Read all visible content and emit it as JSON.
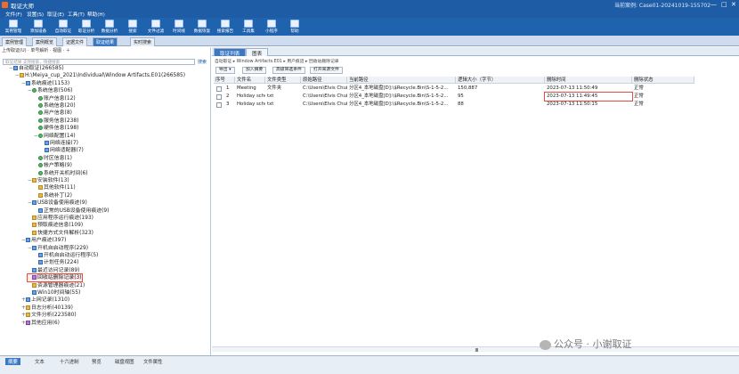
{
  "window": {
    "title": "取证大师",
    "case": "当前案例: Case01-20241019-155702",
    "controls": [
      "—",
      "□",
      "✕"
    ]
  },
  "menu": [
    "文件(F)",
    "设置(S)",
    "取证(E)",
    "工具(T)",
    "帮助(H)"
  ],
  "toolbar": [
    "案例管理",
    "添加设备",
    "自动取证",
    "取证分析",
    "数据分析",
    "搜索",
    "文件过滤",
    "时间线",
    "数据恢复",
    "搜索报告",
    "工具集",
    "小程序",
    "帮助"
  ],
  "tabs": [
    "案例管理",
    "案例概览",
    "证据文件",
    "取证结果",
    "实时搜索"
  ],
  "left": {
    "header": "上传取证(U)  ·  单号解析  ·  视图  ·  ＋",
    "search_placeholder": "取证结果  支持搜索，快捷搜索",
    "search_button": "搜索",
    "tree": [
      {
        "label": "自动取证(266585)",
        "depth": 0,
        "exp": "−",
        "icon": "b"
      },
      {
        "label": "H:\\Meiya_cup_2021\\Individual\\Window Artifacts.E01(266585)",
        "depth": 1,
        "exp": "−",
        "icon": "y"
      },
      {
        "label": "系统痕迹(1153)",
        "depth": 2,
        "exp": "−",
        "icon": "b"
      },
      {
        "label": "系统信息(506)",
        "depth": 3,
        "exp": "−",
        "icon": "g"
      },
      {
        "label": "账户信息(12)",
        "depth": 4,
        "exp": "",
        "icon": "g"
      },
      {
        "label": "系统信息(20)",
        "depth": 4,
        "exp": "",
        "icon": "g"
      },
      {
        "label": "用户信息(8)",
        "depth": 4,
        "exp": "",
        "icon": "g"
      },
      {
        "label": "服务信息(238)",
        "depth": 4,
        "exp": "",
        "icon": "g"
      },
      {
        "label": "硬件信息(198)",
        "depth": 4,
        "exp": "",
        "icon": "g"
      },
      {
        "label": "网络配置(14)",
        "depth": 4,
        "exp": "−",
        "icon": "g"
      },
      {
        "label": "网络连接(7)",
        "depth": 5,
        "exp": "",
        "icon": "b"
      },
      {
        "label": "网络适配器(7)",
        "depth": 5,
        "exp": "",
        "icon": "b"
      },
      {
        "label": "时区信息(1)",
        "depth": 4,
        "exp": "",
        "icon": "g"
      },
      {
        "label": "帐户策略(9)",
        "depth": 4,
        "exp": "",
        "icon": "g"
      },
      {
        "label": "系统开关机时间(6)",
        "depth": 4,
        "exp": "",
        "icon": "g"
      },
      {
        "label": "安装软件(13)",
        "depth": 3,
        "exp": "−",
        "icon": "y"
      },
      {
        "label": "其他软件(11)",
        "depth": 4,
        "exp": "",
        "icon": "y"
      },
      {
        "label": "系统补丁(2)",
        "depth": 4,
        "exp": "",
        "icon": "y"
      },
      {
        "label": "USB设备使用痕迹(9)",
        "depth": 3,
        "exp": "−",
        "icon": "b"
      },
      {
        "label": "正常的USB设备使用痕迹(9)",
        "depth": 4,
        "exp": "",
        "icon": "b"
      },
      {
        "label": "应用程序运行痕迹(193)",
        "depth": 3,
        "exp": "",
        "icon": "y"
      },
      {
        "label": "预取痕迹信息(109)",
        "depth": 3,
        "exp": "",
        "icon": "y"
      },
      {
        "label": "快捷方式文件解析(323)",
        "depth": 3,
        "exp": "",
        "icon": "y"
      },
      {
        "label": "用户痕迹(397)",
        "depth": 2,
        "exp": "−",
        "icon": "b"
      },
      {
        "label": "开机自启动程序(229)",
        "depth": 3,
        "exp": "−",
        "icon": "b"
      },
      {
        "label": "开机自启动运行程序(5)",
        "depth": 4,
        "exp": "",
        "icon": "b"
      },
      {
        "label": "计划任务(224)",
        "depth": 4,
        "exp": "",
        "icon": "b"
      },
      {
        "label": "最近访问记录(89)",
        "depth": 3,
        "exp": "",
        "icon": "b"
      },
      {
        "label": "回收站删除记录(3)",
        "depth": 3,
        "exp": "",
        "icon": "p",
        "sel": true
      },
      {
        "label": "资源管理器痕迹(21)",
        "depth": 3,
        "exp": "",
        "icon": "y"
      },
      {
        "label": "Win10时间轴(55)",
        "depth": 3,
        "exp": "",
        "icon": "b"
      },
      {
        "label": "上网记录(1310)",
        "depth": 2,
        "exp": "+",
        "icon": "b"
      },
      {
        "label": "日志分析(40139)",
        "depth": 2,
        "exp": "+",
        "icon": "y"
      },
      {
        "label": "文件分析(223580)",
        "depth": 2,
        "exp": "+",
        "icon": "y"
      },
      {
        "label": "其他应用(6)",
        "depth": 2,
        "exp": "+",
        "icon": "p"
      }
    ]
  },
  "right": {
    "tabs": [
      "取证列表",
      "图表"
    ],
    "crumbs": "自动取证  ▸  Window Artifacts.E01  ▸  用户痕迹  ▸  回收站删除记录",
    "buttons": [
      "导出 ▾",
      "加入摘要",
      "高级筛选条件",
      "打开来源文件"
    ],
    "columns": [
      "序号",
      "文件名",
      "文件类型",
      "原始路径",
      "当前路径",
      "逻辑大小（字节）",
      "删除时间",
      "删除状态"
    ],
    "rows": [
      [
        "1",
        "Meeting",
        "文件夹",
        "C:\\Users\\Elvis Chui\\Desktop\\Meeting",
        "分区4_本地磁盘[D]:\\$Recycle.Bin\\S-1-5-2...",
        "150,887",
        "2023-07-13 11:50:49",
        "正常"
      ],
      [
        "2",
        "Holiday schedule 202...txt",
        "txt",
        "C:\\Users\\Elvis Chui\\Desktop\\Holiday sche...",
        "分区4_本地磁盘[D]:\\$Recycle.Bin\\S-1-5-2...",
        "95",
        "2023-07-13 11:49:45",
        "正常"
      ],
      [
        "3",
        "Holiday schedule on...",
        "txt",
        "C:\\Users\\Elvis Chui\\Desktop\\Holiday sche...",
        "分区4_本地磁盘[D]:\\$Recycle.Bin\\S-1-5-2...",
        "88",
        "2023-07-13 11:50:15",
        "正常"
      ]
    ]
  },
  "bottom_tabs": [
    "摘要",
    "文本",
    "十六进制",
    "预览",
    "磁盘视图",
    "文件属性"
  ],
  "watermark": "公众号 · 小谢取证"
}
